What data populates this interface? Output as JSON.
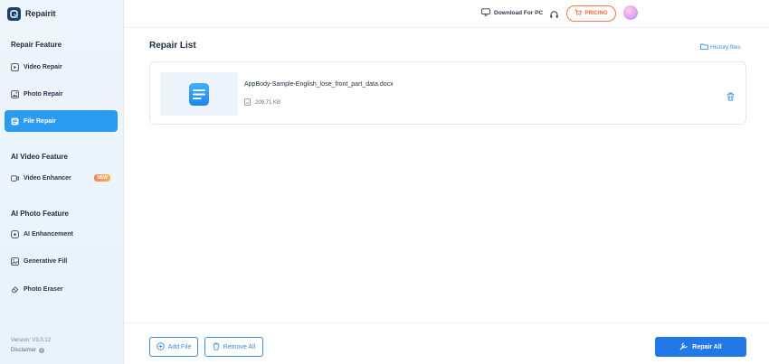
{
  "app": {
    "name": "Repairit"
  },
  "sidebar": {
    "sections": [
      {
        "title": "Repair Feature"
      },
      {
        "title": "AI Video Feature"
      },
      {
        "title": "AI Photo Feature"
      }
    ],
    "items": [
      {
        "label": "Video Repair",
        "icon": "play-square-icon"
      },
      {
        "label": "Photo Repair",
        "icon": "image-icon"
      },
      {
        "label": "File Repair",
        "icon": "document-icon",
        "active": true
      },
      {
        "label": "Video Enhancer",
        "icon": "video-camera-icon",
        "badge": "NEW"
      },
      {
        "label": "AI Enhancement",
        "icon": "sparkle-icon"
      },
      {
        "label": "Generative Fill",
        "icon": "fill-image-icon"
      },
      {
        "label": "Photo Eraser",
        "icon": "eraser-icon"
      }
    ],
    "version": "Version: V3.0.12",
    "disclaimer": "Disclaimer"
  },
  "header": {
    "download_label": "Download For PC",
    "pricing_label": "PRICING"
  },
  "main": {
    "title": "Repair List",
    "history_label": "History files",
    "files": [
      {
        "name": "AppBody-Sample-English_lose_front_part_data.docx",
        "size": "209.71 KB"
      }
    ]
  },
  "footer": {
    "add_file_label": "Add File",
    "remove_all_label": "Remove All",
    "repair_all_label": "Repair All"
  },
  "colors": {
    "accent": "#2b9bf2",
    "primary_button": "#2178e6",
    "pricing": "#f0683a"
  }
}
